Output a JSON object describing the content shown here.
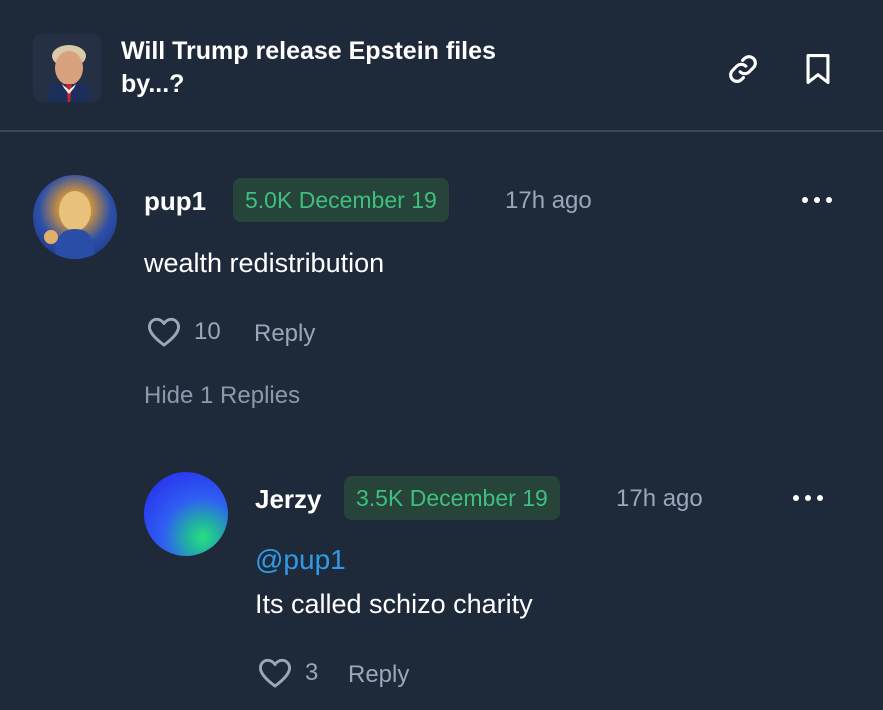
{
  "market": {
    "title": "Will Trump release Epstein files by...?",
    "thumbnail_icon": "market-thumbnail"
  },
  "header_actions": {
    "link_icon": "link-icon",
    "bookmark_icon": "bookmark-icon"
  },
  "comments": [
    {
      "username": "pup1",
      "badge": "5.0K December 19",
      "time_ago": "17h ago",
      "text": "wealth redistribution",
      "likes": "10",
      "reply_label": "Reply",
      "hide_replies_label": "Hide 1 Replies",
      "replies": [
        {
          "username": "Jerzy",
          "badge": "3.5K December 19",
          "time_ago": "17h ago",
          "mention": "@pup1",
          "text": "Its called schizo charity",
          "likes": "3",
          "reply_label": "Reply"
        }
      ]
    }
  ],
  "colors": {
    "background": "#1e2a3a",
    "badge_bg": "#264439",
    "badge_text": "#3fbf7f",
    "muted_text": "#9aa7b8",
    "mention": "#2f9be8"
  }
}
